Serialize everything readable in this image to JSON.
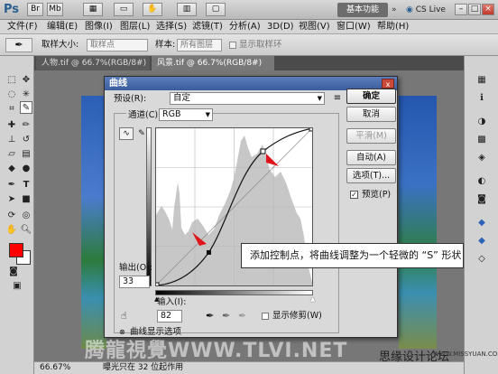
{
  "app": {
    "logo": "Ps",
    "workspace_button": "基本功能",
    "expand_glyph": "»",
    "cs_live": "CS Live",
    "win_minimize": "–",
    "win_restore": "□",
    "win_close": "×"
  },
  "menu": [
    "文件(F)",
    "编辑(E)",
    "图像(I)",
    "图层(L)",
    "选择(S)",
    "滤镜(T)",
    "分析(A)",
    "3D(D)",
    "视图(V)",
    "窗口(W)",
    "帮助(H)"
  ],
  "options_bar": {
    "sample_size_label": "取样大小:",
    "sample_size_value": "取样点",
    "sample_label": "样本:",
    "sample_value": "所有图层",
    "show_ring_label": "显示取样环"
  },
  "tabs": [
    {
      "label": "人物.tif @ 66.7%(RGB/8#)",
      "active": false
    },
    {
      "label": "风景.tif @ 66.7%(RGB/8#)",
      "active": true
    }
  ],
  "status": {
    "zoom": "66.67%",
    "info": "曝光只在 32 位起作用"
  },
  "dialog": {
    "title": "曲线",
    "close_glyph": "x",
    "preset_label": "预设(R):",
    "preset_value": "自定",
    "channel_label": "通道(C):",
    "channel_value": "RGB",
    "output_label": "输出(O):",
    "output_value": "33",
    "input_label": "输入(I):",
    "input_value": "82",
    "show_clipping_label": "显示修剪(W)",
    "curve_options_label": "曲线显示选项",
    "buttons": {
      "ok": "确定",
      "cancel": "取消",
      "smooth": "平滑(M)",
      "auto": "自动(A)",
      "options": "选项(T)...",
      "preview": "预览(P)"
    },
    "preview_checked": true
  },
  "callout": "添加控制点，将曲线调整为一个轻微的 “S” 形状",
  "watermark": {
    "main": "腾龍視覺WWW.TLVI.NET",
    "forum": "思缘设计论坛",
    "site": "WWW.MISSYUAN.COM"
  },
  "colors": {
    "foreground": "#ff0000",
    "background": "#ffffff",
    "accent_arrow": "#e0151b",
    "dialog_title": "#3a5d9c"
  }
}
